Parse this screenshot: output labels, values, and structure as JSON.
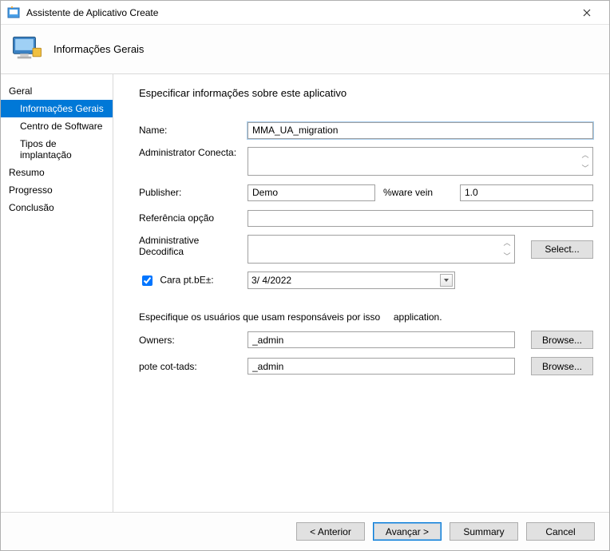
{
  "title": "Assistente de Aplicativo Create",
  "header_title": "Informações Gerais",
  "nav": {
    "geral": "Geral",
    "info": "Informações Gerais",
    "centro": "Centro de Software",
    "tipos": "Tipos de implantação",
    "resumo": "Resumo",
    "progresso": "Progresso",
    "conclusao": "Conclusão"
  },
  "page_heading": "Especificar informações sobre este aplicativo",
  "labels": {
    "name": "Name:",
    "admin_conecta": "Administrator Conecta:",
    "publisher": "Publisher:",
    "ware_vein": "%ware vein",
    "ref_opcao": "Referência opção",
    "admin_decod": "Administrative Decodifica",
    "cara": "Cara pt.bE±:",
    "owners": "Owners:",
    "pote": "pote cot-tads:"
  },
  "values": {
    "name": "MMA_UA_migration",
    "publisher": "Demo",
    "version": "1.0",
    "date": "3/  4/2022",
    "owners": "_admin",
    "pote": "_admin"
  },
  "section_text_a": "Especifique os usuários que usam responsáveis por isso",
  "section_text_b": "application.",
  "buttons": {
    "select": "Select...",
    "browse": "Browse...",
    "anterior": "< Anterior",
    "avancar": "Avançar >",
    "summary": "Summary",
    "cancel": "Cancel"
  }
}
